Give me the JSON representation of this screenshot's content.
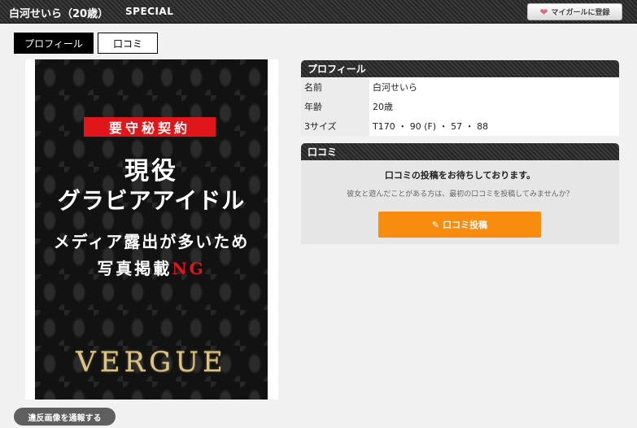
{
  "header": {
    "name": "白河せいら（20歳）",
    "badge": "SPECIAL",
    "mygirl_button": "マイガールに登録",
    "mygirl_icon": "heart-icon"
  },
  "tabs": [
    {
      "label": "プロフィール",
      "active": true
    },
    {
      "label": "口コミ",
      "active": false
    }
  ],
  "photo": {
    "seal": "要守秘契約",
    "line1": "現役",
    "line2": "グラビアアイドル",
    "line3": "メディア露出が多いため",
    "line4_main": "写真掲載",
    "line4_red": "NG",
    "brand": "VERGUE"
  },
  "report_button": "違反画像を通報する",
  "profile": {
    "title": "プロフィール",
    "rows": [
      {
        "key": "名前",
        "value": "白河せいら"
      },
      {
        "key": "年齢",
        "value": "20歳"
      },
      {
        "key": "3サイズ",
        "value": "T170 ・ 90 (F) ・ 57 ・ 88"
      }
    ]
  },
  "review": {
    "title": "口コミ",
    "message": "口コミの投稿をお待ちしております。",
    "sub": "彼女と遊んだことがある方は、最初の口コミを投稿してみませんか？",
    "post_button": "口コミ投稿",
    "post_icon": "pen-icon"
  },
  "colors": {
    "accent_orange": "#f78c0f",
    "seal_red": "#e0161b",
    "header_dark": "#262626"
  }
}
